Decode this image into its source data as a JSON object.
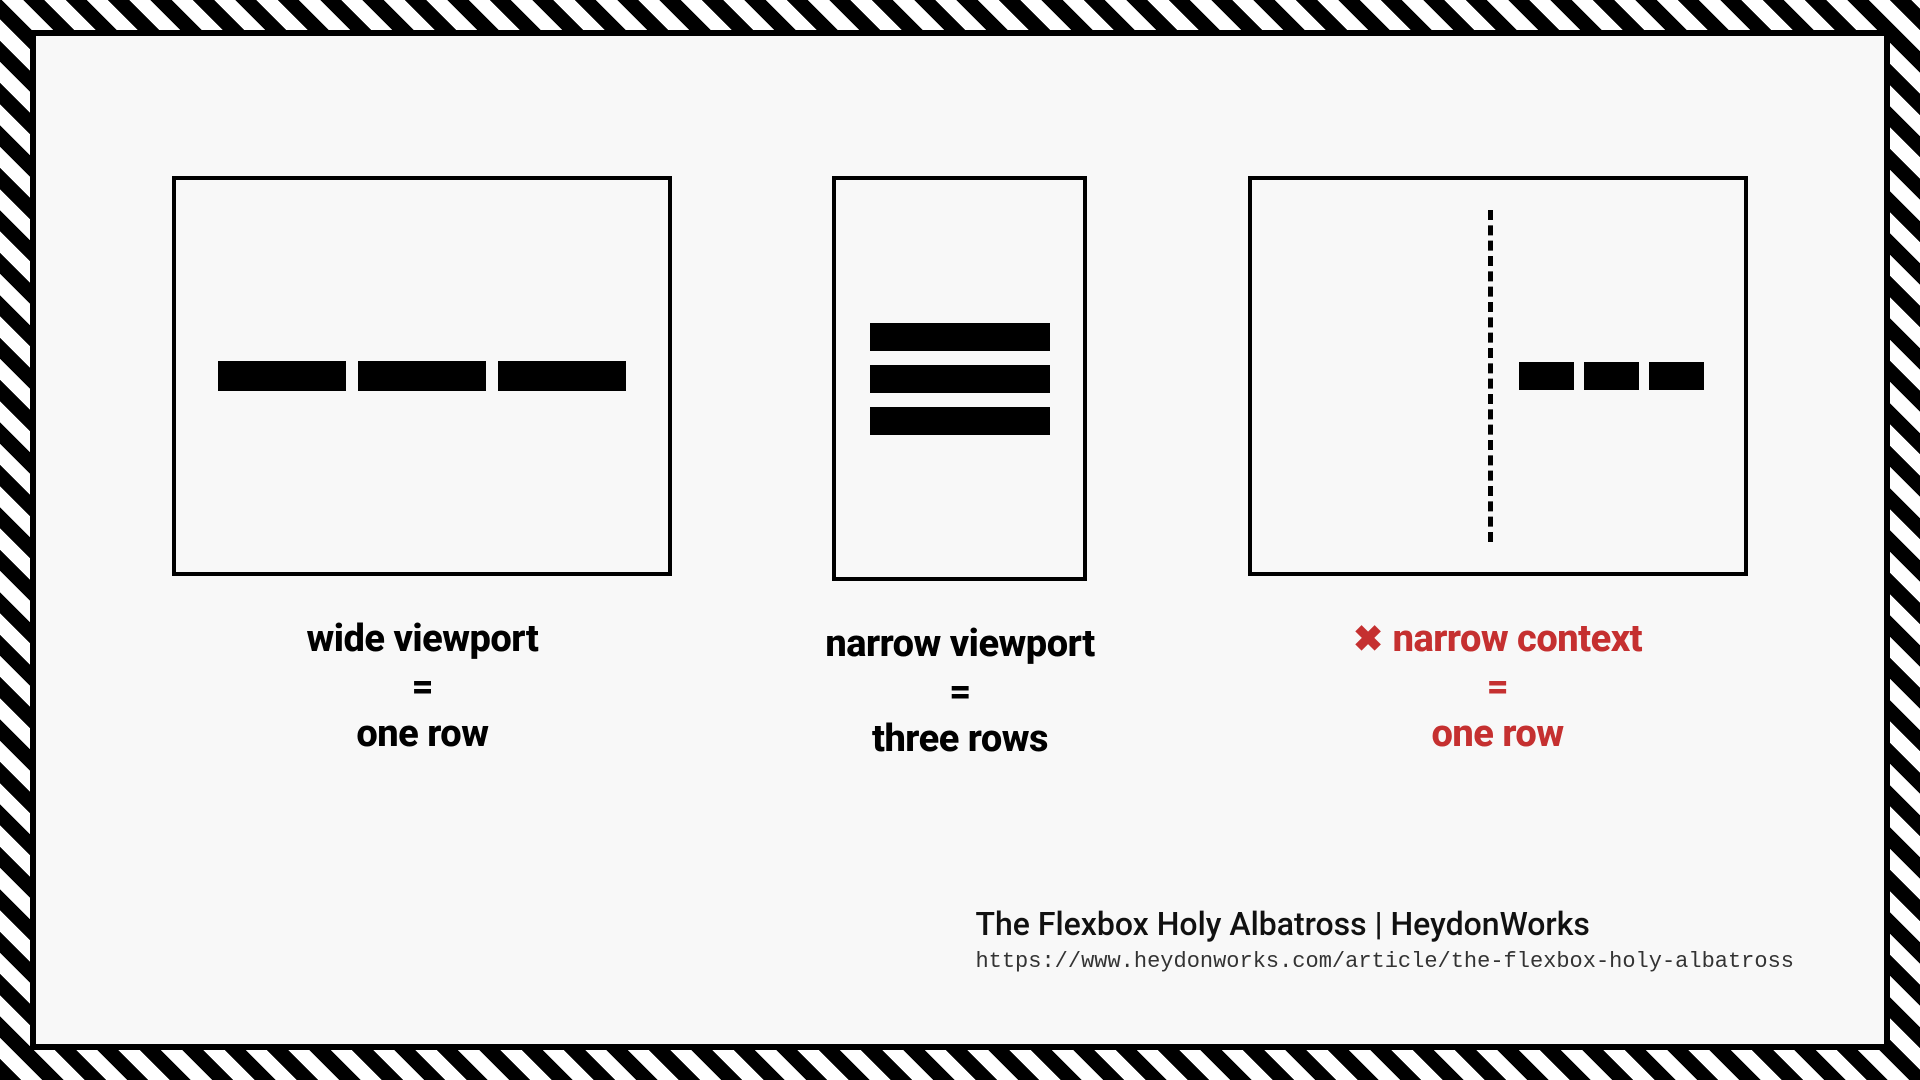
{
  "panels": [
    {
      "line1": "wide viewport",
      "eq": "=",
      "line3": "one row",
      "error": false,
      "layout": "wide"
    },
    {
      "line1": "narrow viewport",
      "eq": "=",
      "line3": "three rows",
      "error": false,
      "layout": "narrow"
    },
    {
      "line1": "narrow context",
      "eq": "=",
      "line3": "one row",
      "error": true,
      "layout": "context"
    }
  ],
  "error_marker": "✖",
  "attribution": {
    "title": "The Flexbox Holy Albatross | HeydonWorks",
    "url": "https://www.heydonworks.com/article/the-flexbox-holy-albatross"
  }
}
